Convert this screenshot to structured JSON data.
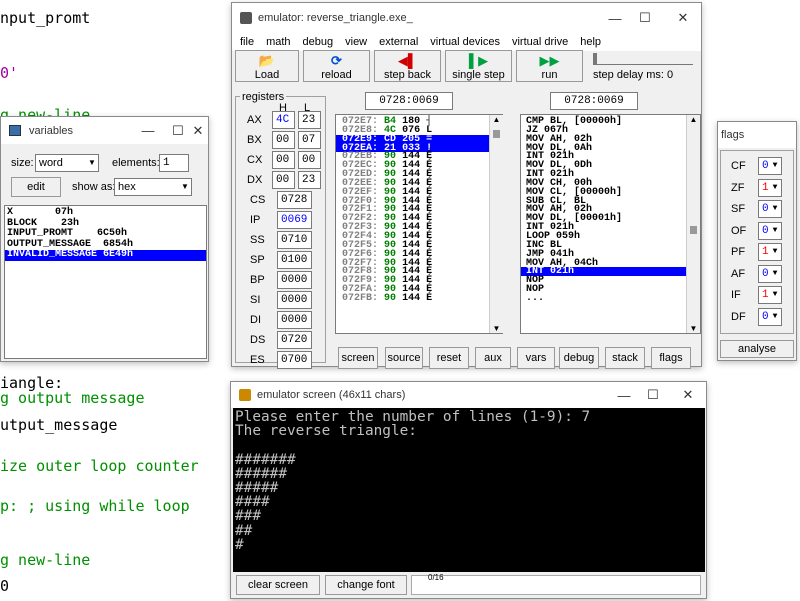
{
  "bg_code": [
    {
      "text": "nput_promt",
      "color": "#000000"
    },
    {
      "text": "0'",
      "color": "#a000a0"
    },
    {
      "text": "g new-line",
      "color": "#009000"
    },
    {
      "text": "iangle:",
      "color": "#000000"
    },
    {
      "text": "g output message",
      "color": "#009000"
    },
    {
      "text": "utput_message",
      "color": "#000000"
    },
    {
      "text": "ize outer loop counter",
      "color": "#009000"
    },
    {
      "text": "p: ; using while loop",
      "color": "#009000"
    },
    {
      "text": "g new-line",
      "color": "#009000"
    },
    {
      "text": "0",
      "color": "#000000"
    }
  ],
  "emulator": {
    "title": "emulator: reverse_triangle.exe_",
    "menu": [
      "file",
      "math",
      "debug",
      "view",
      "external",
      "virtual devices",
      "virtual drive",
      "help"
    ],
    "toolbar": {
      "load": "Load",
      "reload": "reload",
      "step_back": "step back",
      "single_step": "single step",
      "run": "run",
      "delay_label": "step delay ms: 0"
    },
    "registers_label": "registers",
    "h_label": "H",
    "l_label": "L",
    "regs8": [
      {
        "name": "AX",
        "h": "4C",
        "l": "23"
      },
      {
        "name": "BX",
        "h": "00",
        "l": "07"
      },
      {
        "name": "CX",
        "h": "00",
        "l": "00"
      },
      {
        "name": "DX",
        "h": "00",
        "l": "23"
      }
    ],
    "regs16": [
      {
        "name": "CS",
        "val": "0728"
      },
      {
        "name": "IP",
        "val": "0069"
      },
      {
        "name": "SS",
        "val": "0710"
      },
      {
        "name": "SP",
        "val": "0100"
      },
      {
        "name": "BP",
        "val": "0000"
      },
      {
        "name": "SI",
        "val": "0000"
      },
      {
        "name": "DI",
        "val": "0000"
      },
      {
        "name": "DS",
        "val": "0720"
      },
      {
        "name": "ES",
        "val": "0700"
      }
    ],
    "addr_left": "0728:0069",
    "addr_right": "0728:0069",
    "memory": [
      {
        "a": "072E7:",
        "h": "B4",
        "d": "180",
        "c": "┤",
        "sel": false
      },
      {
        "a": "072E8:",
        "h": "4C",
        "d": "076",
        "c": "L",
        "sel": false
      },
      {
        "a": "072E9:",
        "h": "CD",
        "d": "205",
        "c": "=",
        "sel": true
      },
      {
        "a": "072EA:",
        "h": "21",
        "d": "033",
        "c": "!",
        "sel": true
      },
      {
        "a": "072EB:",
        "h": "90",
        "d": "144",
        "c": "É",
        "sel": false
      },
      {
        "a": "072EC:",
        "h": "90",
        "d": "144",
        "c": "É",
        "sel": false
      },
      {
        "a": "072ED:",
        "h": "90",
        "d": "144",
        "c": "É",
        "sel": false
      },
      {
        "a": "072EE:",
        "h": "90",
        "d": "144",
        "c": "É",
        "sel": false
      },
      {
        "a": "072EF:",
        "h": "90",
        "d": "144",
        "c": "É",
        "sel": false
      },
      {
        "a": "072F0:",
        "h": "90",
        "d": "144",
        "c": "É",
        "sel": false
      },
      {
        "a": "072F1:",
        "h": "90",
        "d": "144",
        "c": "É",
        "sel": false
      },
      {
        "a": "072F2:",
        "h": "90",
        "d": "144",
        "c": "É",
        "sel": false
      },
      {
        "a": "072F3:",
        "h": "90",
        "d": "144",
        "c": "É",
        "sel": false
      },
      {
        "a": "072F4:",
        "h": "90",
        "d": "144",
        "c": "É",
        "sel": false
      },
      {
        "a": "072F5:",
        "h": "90",
        "d": "144",
        "c": "É",
        "sel": false
      },
      {
        "a": "072F6:",
        "h": "90",
        "d": "144",
        "c": "É",
        "sel": false
      },
      {
        "a": "072F7:",
        "h": "90",
        "d": "144",
        "c": "É",
        "sel": false
      },
      {
        "a": "072F8:",
        "h": "90",
        "d": "144",
        "c": "É",
        "sel": false
      },
      {
        "a": "072F9:",
        "h": "90",
        "d": "144",
        "c": "É",
        "sel": false
      },
      {
        "a": "072FA:",
        "h": "90",
        "d": "144",
        "c": "É",
        "sel": false
      },
      {
        "a": "072FB:",
        "h": "90",
        "d": "144",
        "c": "É",
        "sel": false
      }
    ],
    "disasm": [
      {
        "t": "CMP BL, [00000h]",
        "sel": false
      },
      {
        "t": "JZ 067h",
        "sel": false
      },
      {
        "t": "MOV AH, 02h",
        "sel": false
      },
      {
        "t": "MOV DL, 0Ah",
        "sel": false
      },
      {
        "t": "INT 021h",
        "sel": false
      },
      {
        "t": "MOV DL, 0Dh",
        "sel": false
      },
      {
        "t": "INT 021h",
        "sel": false
      },
      {
        "t": "MOV CH, 00h",
        "sel": false
      },
      {
        "t": "MOV CL, [00000h]",
        "sel": false
      },
      {
        "t": "SUB CL, BL",
        "sel": false
      },
      {
        "t": "MOV AH, 02h",
        "sel": false
      },
      {
        "t": "MOV DL, [00001h]",
        "sel": false
      },
      {
        "t": "INT 021h",
        "sel": false
      },
      {
        "t": "LOOP 059h",
        "sel": false
      },
      {
        "t": "INC BL",
        "sel": false
      },
      {
        "t": "JMP 041h",
        "sel": false
      },
      {
        "t": "MOV AH, 04Ch",
        "sel": false
      },
      {
        "t": "INT 021h",
        "sel": true
      },
      {
        "t": "NOP",
        "sel": false
      },
      {
        "t": "NOP",
        "sel": false
      },
      {
        "t": "...",
        "sel": false
      }
    ],
    "bottom_buttons": [
      "screen",
      "source",
      "reset",
      "aux",
      "vars",
      "debug",
      "stack",
      "flags"
    ]
  },
  "variables": {
    "title": "variables",
    "size_label": "size:",
    "size_value": "word",
    "elements_label": "elements:",
    "elements_value": "1",
    "edit_label": "edit",
    "show_as_label": "show as:",
    "show_as_value": "hex",
    "items": [
      {
        "t": "X       07h",
        "sel": false
      },
      {
        "t": "BLOCK    23h",
        "sel": false
      },
      {
        "t": "INPUT_PROMT    6C50h",
        "sel": false
      },
      {
        "t": "OUTPUT_MESSAGE  6854h",
        "sel": false
      },
      {
        "t": "INVALID_MESSAGE 6E49h",
        "sel": true
      }
    ]
  },
  "flags": {
    "title": "flags",
    "items": [
      {
        "name": "CF",
        "val": "0",
        "color": "#0000ff"
      },
      {
        "name": "ZF",
        "val": "1",
        "color": "#ff0000"
      },
      {
        "name": "SF",
        "val": "0",
        "color": "#0000ff"
      },
      {
        "name": "OF",
        "val": "0",
        "color": "#0000ff"
      },
      {
        "name": "PF",
        "val": "1",
        "color": "#ff0000"
      },
      {
        "name": "AF",
        "val": "0",
        "color": "#0000ff"
      },
      {
        "name": "IF",
        "val": "1",
        "color": "#ff0000"
      },
      {
        "name": "DF",
        "val": "0",
        "color": "#0000ff"
      }
    ],
    "analyse": "analyse"
  },
  "screen": {
    "title": "emulator screen (46x11 chars)",
    "lines": [
      "Please enter the number of lines (1-9): 7",
      "The reverse triangle:",
      "",
      "#######",
      "######",
      "#####",
      "####",
      "###",
      "##",
      "#"
    ],
    "clear_label": "clear screen",
    "font_label": "change font",
    "counter": "0/16"
  }
}
